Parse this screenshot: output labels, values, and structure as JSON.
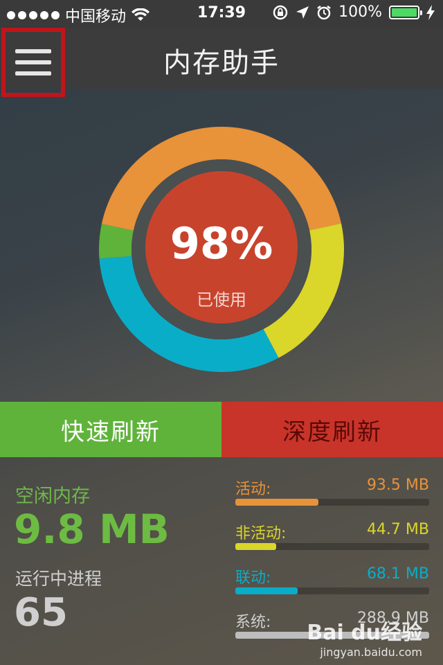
{
  "status_bar": {
    "carrier": "中国移动",
    "time": "17:39",
    "battery": "100%"
  },
  "nav": {
    "title": "内存助手"
  },
  "ring": {
    "percent_label": "98%",
    "caption": "已使用",
    "segments": [
      {
        "name": "activity",
        "value": 93.5,
        "color": "#e8923a"
      },
      {
        "name": "inactive",
        "value": 44.7,
        "color": "#dad62a"
      },
      {
        "name": "wired",
        "value": 68.1,
        "color": "#0aadc8"
      },
      {
        "name": "free",
        "value": 9.8,
        "color": "#5fb33a"
      }
    ]
  },
  "buttons": {
    "quick": "快速刷新",
    "deep": "深度刷新"
  },
  "summary": {
    "free_label": "空闲内存",
    "free_value": "9.8 MB",
    "process_label": "运行中进程",
    "process_value": "65"
  },
  "stats": [
    {
      "label": "活动:",
      "value": "93.5 MB",
      "fraction": 0.43,
      "color": "#e8923a"
    },
    {
      "label": "非活动:",
      "value": "44.7 MB",
      "fraction": 0.21,
      "color": "#dad62a"
    },
    {
      "label": "联动:",
      "value": "68.1 MB",
      "fraction": 0.32,
      "color": "#0aadc8"
    },
    {
      "label": "系统:",
      "value": "288.9 MB",
      "fraction": 1.0,
      "color": "#bdbdbd"
    }
  ],
  "watermark": {
    "logo": "Bai du经验",
    "site": "jingyan.baidu.com"
  }
}
